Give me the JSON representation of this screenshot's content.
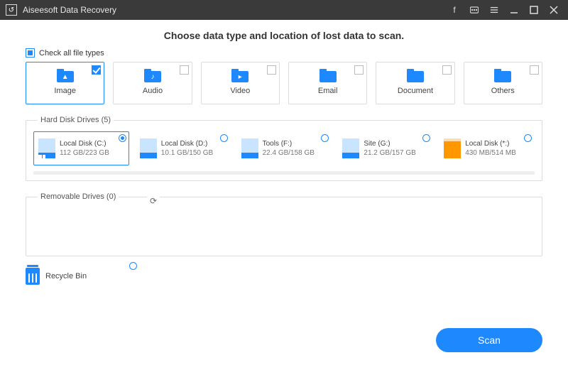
{
  "titlebar": {
    "app_name": "Aiseesoft Data Recovery"
  },
  "heading": "Choose data type and location of lost data to scan.",
  "check_all_label": "Check all file types",
  "types": [
    {
      "label": "Image",
      "icon": "image",
      "selected": true,
      "glyph": "▲"
    },
    {
      "label": "Audio",
      "icon": "audio",
      "selected": false,
      "glyph": "♪"
    },
    {
      "label": "Video",
      "icon": "video",
      "selected": false,
      "glyph": "▸"
    },
    {
      "label": "Email",
      "icon": "email",
      "selected": false,
      "glyph": ""
    },
    {
      "label": "Document",
      "icon": "document",
      "selected": false,
      "glyph": ""
    },
    {
      "label": "Others",
      "icon": "others",
      "selected": false,
      "glyph": ""
    }
  ],
  "hdd_legend": "Hard Disk Drives (5)",
  "drives": [
    {
      "name": "Local Disk (C:)",
      "capacity": "112 GB/223 GB",
      "selected": true,
      "os": true,
      "color": "blue"
    },
    {
      "name": "Local Disk (D:)",
      "capacity": "10.1 GB/150 GB",
      "selected": false,
      "os": false,
      "color": "blue"
    },
    {
      "name": "Tools (F:)",
      "capacity": "22.4 GB/158 GB",
      "selected": false,
      "os": false,
      "color": "blue"
    },
    {
      "name": "Site (G:)",
      "capacity": "21.2 GB/157 GB",
      "selected": false,
      "os": false,
      "color": "blue"
    },
    {
      "name": "Local Disk (*:)",
      "capacity": "430 MB/514 MB",
      "selected": false,
      "os": false,
      "color": "orange"
    }
  ],
  "removable_legend": "Removable Drives (0)",
  "recycle_label": "Recycle Bin",
  "scan_label": "Scan"
}
